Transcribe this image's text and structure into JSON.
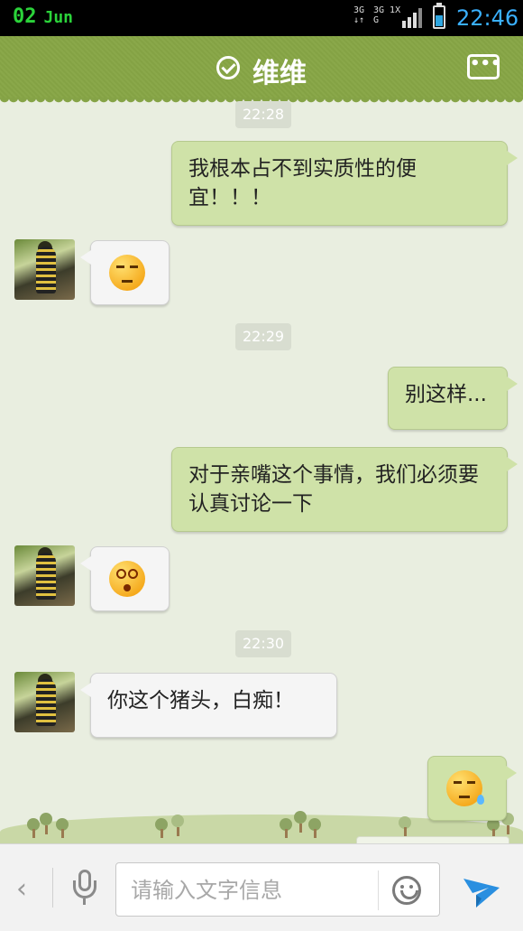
{
  "status_bar": {
    "day": "02",
    "month": "Jun",
    "net1_top": "3G",
    "net1_bot": "↓↑",
    "net2_top": "3G 1X",
    "net2_bot": "G",
    "time": "22:46",
    "battery_level": 0.55,
    "accent_color": "#2bd33a"
  },
  "header": {
    "title": "维维",
    "status_icon": "check-circle-icon",
    "more_icon": "more-icon",
    "more_label": "•••",
    "color": "#8aa84a"
  },
  "messages": [
    {
      "type": "timestamp",
      "text": "22:28"
    },
    {
      "type": "text",
      "direction": "out",
      "text": "我根本占不到实质性的便宜！！！"
    },
    {
      "type": "emoji",
      "direction": "in",
      "emoji": "grumpy-face-icon"
    },
    {
      "type": "timestamp",
      "text": "22:29"
    },
    {
      "type": "text",
      "direction": "out",
      "text": "别这样..."
    },
    {
      "type": "text",
      "direction": "out",
      "text": "对于亲嘴这个事情，我们必须要认真讨论一下"
    },
    {
      "type": "emoji",
      "direction": "in",
      "emoji": "dizzy-face-icon"
    },
    {
      "type": "timestamp",
      "text": "22:30"
    },
    {
      "type": "text",
      "direction": "in",
      "text": "你这个猪头，白痴！"
    },
    {
      "type": "emoji",
      "direction": "out",
      "emoji": "sweat-face-icon"
    }
  ],
  "input_bar": {
    "back_icon": "chevron-left-icon",
    "mic_icon": "microphone-icon",
    "placeholder": "请输入文字信息",
    "value": "",
    "emoji_icon": "smiley-icon",
    "send_icon": "send-icon",
    "send_color": "#2a8fe0"
  }
}
